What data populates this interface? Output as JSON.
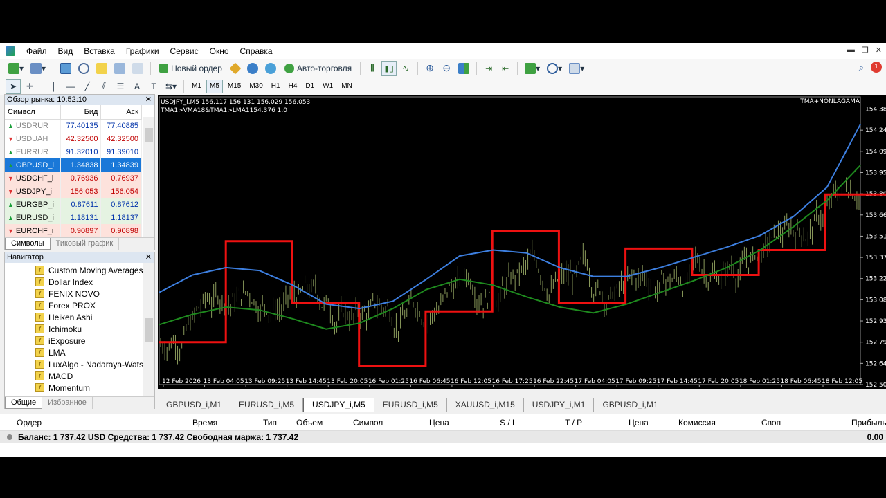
{
  "menu": [
    "Файл",
    "Вид",
    "Вставка",
    "Графики",
    "Сервис",
    "Окно",
    "Справка"
  ],
  "toolbar": {
    "new_order": "Новый ордер",
    "auto_trading": "Авто-торговля",
    "notifications_badge": "1"
  },
  "timeframes": [
    "M1",
    "M5",
    "M15",
    "M30",
    "H1",
    "H4",
    "D1",
    "W1",
    "MN"
  ],
  "active_timeframe": "M5",
  "market_watch": {
    "title": "Обзор рынка: 10:52:10",
    "col_symbol": "Символ",
    "col_bid": "Бид",
    "col_ask": "Аск",
    "rows": [
      {
        "symbol": "USDRUR",
        "bid": "77.40135",
        "ask": "77.40885",
        "dir": "up",
        "style": "grey"
      },
      {
        "symbol": "USDUAH",
        "bid": "42.32500",
        "ask": "42.32500",
        "dir": "down",
        "style": "grey"
      },
      {
        "symbol": "EURRUR",
        "bid": "91.32010",
        "ask": "91.39010",
        "dir": "up",
        "style": "grey"
      },
      {
        "symbol": "GBPUSD_i",
        "bid": "1.34838",
        "ask": "1.34839",
        "dir": "up",
        "style": "sel"
      },
      {
        "symbol": "USDCHF_i",
        "bid": "0.76936",
        "ask": "0.76937",
        "dir": "down",
        "style": "red"
      },
      {
        "symbol": "USDJPY_i",
        "bid": "156.053",
        "ask": "156.054",
        "dir": "down",
        "style": "red"
      },
      {
        "symbol": "EURGBP_i",
        "bid": "0.87611",
        "ask": "0.87612",
        "dir": "up",
        "style": "green"
      },
      {
        "symbol": "EURUSD_i",
        "bid": "1.18131",
        "ask": "1.18137",
        "dir": "up",
        "style": "green"
      },
      {
        "symbol": "EURCHF_i",
        "bid": "0.90897",
        "ask": "0.90898",
        "dir": "down",
        "style": "red"
      }
    ],
    "tabs": [
      "Символы",
      "Тиковый график"
    ]
  },
  "navigator": {
    "title": "Навигатор",
    "items": [
      "Custom Moving Averages",
      "Dollar Index",
      "FENIX NOVO",
      "Forex PROX",
      "Heiken Ashi",
      "Ichimoku",
      "iExposure",
      "LMA",
      "LuxAlgo - Nadaraya-Watson",
      "MACD",
      "Momentum"
    ],
    "tabs": [
      "Общие",
      "Избранное"
    ]
  },
  "chart": {
    "header": "USDJPY_i,M5  156.117 156.131 156.029 156.053",
    "subheader": "TMA1>VMA18&TMA1>LMA1154.376 1.0",
    "indicator_label": "TMA+NONLAGAMA",
    "colors": {
      "candles": "#8a9a5b",
      "blue_ma": "#3d7fe0",
      "green_ma": "#1e8a1e",
      "red_step": "#ee1111"
    }
  },
  "chart_data": {
    "type": "line",
    "title": "USDJPY_i,M5",
    "y_ticks": [
      "154.385",
      "154.240",
      "154.095",
      "153.950",
      "153.805",
      "153.660",
      "153.515",
      "153.370",
      "153.225",
      "153.080",
      "152.935",
      "152.790",
      "152.645",
      "152.500"
    ],
    "x_ticks": [
      "12 Feb 2026",
      "13 Feb 04:05",
      "13 Feb 09:25",
      "13 Feb 14:45",
      "13 Feb 20:05",
      "16 Feb 01:25",
      "16 Feb 06:45",
      "16 Feb 12:05",
      "16 Feb 17:25",
      "16 Feb 22:45",
      "17 Feb 04:05",
      "17 Feb 09:25",
      "17 Feb 14:45",
      "17 Feb 20:05",
      "18 Feb 01:25",
      "18 Feb 06:45",
      "18 Feb 12:05"
    ],
    "ylim": [
      152.5,
      154.43
    ],
    "series": [
      {
        "name": "",
        "color": "#ee1111",
        "values": [
          152.79,
          152.79,
          153.48,
          153.48,
          153.06,
          153.06,
          152.63,
          152.63,
          153.0,
          153.0,
          153.55,
          153.55,
          153.06,
          153.06,
          153.43,
          153.43,
          153.25,
          153.25,
          153.42,
          153.42,
          153.8,
          153.8
        ]
      },
      {
        "name": "",
        "color": "#3d7fe0",
        "values": [
          153.13,
          153.25,
          153.3,
          153.28,
          153.18,
          153.05,
          153.02,
          153.07,
          153.22,
          153.38,
          153.42,
          153.4,
          153.3,
          153.24,
          153.24,
          153.3,
          153.37,
          153.44,
          153.52,
          153.65,
          153.85,
          154.28
        ]
      },
      {
        "name": "",
        "color": "#1e8a1e",
        "values": [
          152.91,
          152.98,
          153.03,
          153.01,
          152.95,
          152.88,
          152.92,
          153.02,
          153.15,
          153.22,
          153.18,
          153.1,
          153.03,
          152.99,
          153.05,
          153.13,
          153.21,
          153.3,
          153.42,
          153.58,
          153.76,
          154.0
        ]
      }
    ]
  },
  "chart_tabs": [
    "GBPUSD_i,M1",
    "EURUSD_i,M5",
    "USDJPY_i,M5",
    "EURUSD_i,M5",
    "XAUUSD_i,M15",
    "USDJPY_i,M1",
    "GBPUSD_i,M1"
  ],
  "active_chart_tab": 2,
  "terminal": {
    "columns": [
      "Ордер",
      "Время",
      "Тип",
      "Объем",
      "Символ",
      "Цена",
      "S / L",
      "T / P",
      "Цена",
      "Комиссия",
      "Своп",
      "Прибыль"
    ],
    "balance_line": "Баланс: 1 737.42 USD  Средства: 1 737.42  Свободная маржа: 1 737.42",
    "profit": "0.00"
  }
}
